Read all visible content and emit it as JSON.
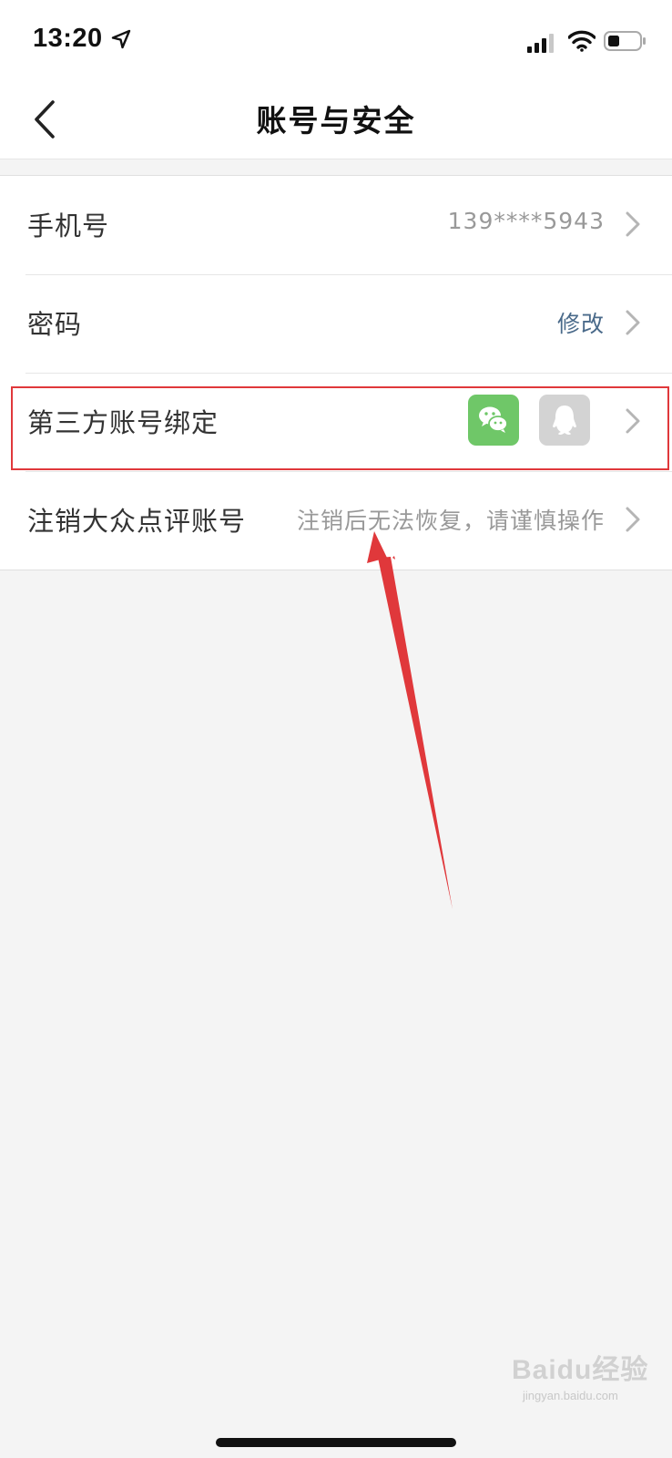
{
  "status_bar": {
    "time": "13:20",
    "icons": [
      "location-arrow-icon",
      "cellular-signal-icon",
      "wifi-icon",
      "battery-icon"
    ]
  },
  "header": {
    "title": "账号与安全",
    "back_icon": "chevron-left-icon"
  },
  "settings": {
    "rows": [
      {
        "label": "手机号",
        "value": "139****5943"
      },
      {
        "label": "密码",
        "value": "修改"
      },
      {
        "label": "第三方账号绑定",
        "value": "",
        "bindings": [
          "wechat-icon",
          "qq-icon"
        ]
      },
      {
        "label": "注销大众点评账号",
        "value": "注销后无法恢复，请谨慎操作"
      }
    ]
  },
  "annotation": {
    "highlight_color": "#e0383b",
    "arrow_color": "#e0383b"
  },
  "watermark": {
    "text": "Baidu经验",
    "subtext": "jingyan.baidu.com"
  },
  "colors": {
    "wechat": "#6fc768",
    "qq_inactive": "#d3d3d3",
    "link": "#4a6a8a",
    "background": "#f4f4f4"
  }
}
